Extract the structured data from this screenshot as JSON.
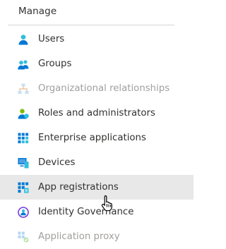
{
  "section": {
    "title": "Manage"
  },
  "items": [
    {
      "label": "Users",
      "icon": "users-icon",
      "disabled": false,
      "selected": false
    },
    {
      "label": "Groups",
      "icon": "groups-icon",
      "disabled": false,
      "selected": false
    },
    {
      "label": "Organizational relationships",
      "icon": "organizational-relationships-icon",
      "disabled": true,
      "selected": false
    },
    {
      "label": "Roles and administrators",
      "icon": "roles-icon",
      "disabled": false,
      "selected": false
    },
    {
      "label": "Enterprise applications",
      "icon": "enterprise-apps-icon",
      "disabled": false,
      "selected": false
    },
    {
      "label": "Devices",
      "icon": "devices-icon",
      "disabled": false,
      "selected": false
    },
    {
      "label": "App registrations",
      "icon": "app-registrations-icon",
      "disabled": false,
      "selected": true
    },
    {
      "label": "Identity Governance",
      "icon": "identity-governance-icon",
      "disabled": false,
      "selected": false
    },
    {
      "label": "Application proxy",
      "icon": "application-proxy-icon",
      "disabled": true,
      "selected": false
    }
  ],
  "colors": {
    "accent_blue": "#0078d4",
    "teal": "#32bedd",
    "green": "#7fba00",
    "purple": "#773adc",
    "selected_bg": "#e8e8e8",
    "disabled_text": "#a19f9d"
  }
}
